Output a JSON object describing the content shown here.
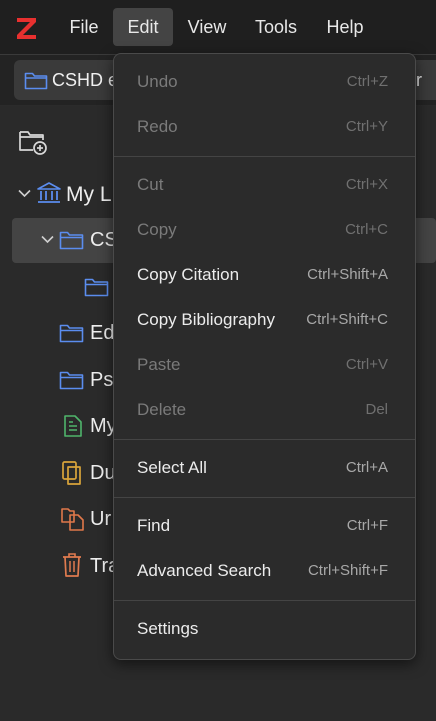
{
  "menubar": {
    "file": "File",
    "edit": "Edit",
    "view": "View",
    "tools": "Tools",
    "help": "Help"
  },
  "tab": {
    "title": "CSHD e",
    "suffix": "ver"
  },
  "tree": {
    "my_library": "My L",
    "cs": "CS",
    "ed": "Ed",
    "ps": "Ps",
    "my": "My",
    "du": "Du",
    "ur": "Ur",
    "tra": "Tra"
  },
  "edit_menu": {
    "undo": {
      "label": "Undo",
      "shortcut": "Ctrl+Z"
    },
    "redo": {
      "label": "Redo",
      "shortcut": "Ctrl+Y"
    },
    "cut": {
      "label": "Cut",
      "shortcut": "Ctrl+X"
    },
    "copy": {
      "label": "Copy",
      "shortcut": "Ctrl+C"
    },
    "copy_citation": {
      "label": "Copy Citation",
      "shortcut": "Ctrl+Shift+A"
    },
    "copy_bibliography": {
      "label": "Copy Bibliography",
      "shortcut": "Ctrl+Shift+C"
    },
    "paste": {
      "label": "Paste",
      "shortcut": "Ctrl+V"
    },
    "delete": {
      "label": "Delete",
      "shortcut": "Del"
    },
    "select_all": {
      "label": "Select All",
      "shortcut": "Ctrl+A"
    },
    "find": {
      "label": "Find",
      "shortcut": "Ctrl+F"
    },
    "advanced_search": {
      "label": "Advanced Search",
      "shortcut": "Ctrl+Shift+F"
    },
    "settings": {
      "label": "Settings",
      "shortcut": ""
    }
  },
  "colors": {
    "logo_red": "#e8302f",
    "folder_blue": "#5b8def",
    "library_blue": "#5b8def",
    "note_green": "#4fb56b",
    "duplicate_yellow": "#d9a43a",
    "unfiled_orange": "#e0784a",
    "trash_orange": "#e07b4f"
  },
  "icons": {
    "logo": "zotero-logo-icon",
    "new_collection": "new-collection-icon",
    "library": "library-icon",
    "folder": "folder-icon",
    "note": "note-icon",
    "duplicates": "duplicates-icon",
    "unfiled": "unfiled-icon",
    "trash": "trash-icon"
  }
}
